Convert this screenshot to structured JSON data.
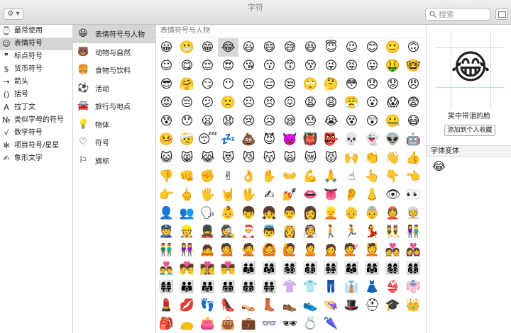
{
  "window": {
    "title": "字符"
  },
  "toolbar": {
    "gear_label": "⚙ ▾"
  },
  "search": {
    "placeholder": "搜索"
  },
  "categories": [
    {
      "icon": "⌚",
      "label": "最常使用",
      "selected": false
    },
    {
      "icon": "☺",
      "label": "表情符号",
      "selected": true
    },
    {
      "icon": "❞",
      "label": "标点符号",
      "selected": false
    },
    {
      "icon": "$",
      "label": "货币符号",
      "selected": false
    },
    {
      "icon": "→",
      "label": "箭头",
      "selected": false
    },
    {
      "icon": "()",
      "label": "括号",
      "selected": false
    },
    {
      "icon": "A",
      "label": "拉丁文",
      "selected": false
    },
    {
      "icon": "№",
      "label": "类似字母的符号",
      "selected": false
    },
    {
      "icon": "√",
      "label": "数学符号",
      "selected": false
    },
    {
      "icon": "✻",
      "label": "项目符号/星星",
      "selected": false
    },
    {
      "icon": "✍",
      "label": "象形文字",
      "selected": false
    }
  ],
  "subcategories": [
    {
      "icon": "😀",
      "label": "表情符号与人物",
      "selected": true
    },
    {
      "icon": "🐻",
      "label": "动物与自然",
      "selected": false
    },
    {
      "icon": "🍔",
      "label": "食物与饮料",
      "selected": false
    },
    {
      "icon": "⚽",
      "label": "活动",
      "selected": false
    },
    {
      "icon": "🚘",
      "label": "旅行与地点",
      "selected": false
    },
    {
      "icon": "💡",
      "label": "物体",
      "selected": false
    },
    {
      "icon": "♡",
      "label": "符号",
      "selected": false
    },
    {
      "icon": "⚐",
      "label": "旗标",
      "selected": false
    }
  ],
  "grid": {
    "heading": "表情符号与人物",
    "selected_index": 3,
    "rows": [
      [
        "😀",
        "😬",
        "😁",
        "😂",
        "😃",
        "😄",
        "😅",
        "😆",
        "😇",
        "😉",
        "😊",
        "🙂",
        "🙃"
      ],
      [
        "☺",
        "😋",
        "😌",
        "😍",
        "😘",
        "😗",
        "😙",
        "😚",
        "😜",
        "😝",
        "😛",
        "🤑",
        "🤓"
      ],
      [
        "😎",
        "🤗",
        "😏",
        "😶",
        "😐",
        "😑",
        "😒",
        "🙄",
        "🤔",
        "😳",
        "😞",
        "😟",
        "😠"
      ],
      [
        "😡",
        "😔",
        "😕",
        "🙁",
        "☹",
        "😣",
        "😖",
        "😫",
        "😩",
        "😤",
        "😮",
        "😱",
        "😨"
      ],
      [
        "😰",
        "😯",
        "😦",
        "😧",
        "😢",
        "😥",
        "😪",
        "😓",
        "😭",
        "😵",
        "😲",
        "🤐",
        "😷"
      ],
      [
        "🤒",
        "🤕",
        "😴",
        "💤",
        "💩",
        "😈",
        "👿",
        "👹",
        "👺",
        "💀",
        "👻",
        "👽",
        "🤖"
      ],
      [
        "😺",
        "😸",
        "😹",
        "😻",
        "😼",
        "😽",
        "🙀",
        "😿",
        "😾",
        "🙌",
        "👏",
        "👋",
        "👍"
      ],
      [
        "👎",
        "👊",
        "✊",
        "✌",
        "👌",
        "✋",
        "👐",
        "💪",
        "🙏",
        "☝",
        "👆",
        "👇",
        "👈"
      ],
      [
        "👉",
        "🖕",
        "🖐",
        "🤘",
        "🖖",
        "✍",
        "💅",
        "👄",
        "👅",
        "👂",
        "👃",
        "👁",
        "👀"
      ],
      [
        "👤",
        "👥",
        "🗣",
        "👶",
        "👦",
        "👧",
        "👨",
        "👩",
        "👱",
        "👴",
        "👵",
        "👲",
        "👳"
      ],
      [
        "👮",
        "👷",
        "💂",
        "🕵",
        "🎅",
        "👼",
        "👸",
        "👰",
        "🚶",
        "🏃",
        "💃",
        "👯",
        "👫"
      ],
      [
        "👬",
        "👭",
        "🙇",
        "💁",
        "🙅",
        "🙆",
        "🙋",
        "🙎",
        "🙍",
        "💇",
        "💆",
        "💑",
        "👩‍❤️‍👩"
      ],
      [
        "👨‍❤️‍👨",
        "💏",
        "👩‍❤️‍💋‍👩",
        "👨‍❤️‍💋‍👨",
        "👪",
        "👨‍👩‍👧",
        "👨‍👩‍👧‍👦",
        "👨‍👩‍👦‍👦",
        "👨‍👩‍👧‍👧",
        "👩‍👩‍👦",
        "👩‍👩‍👧",
        "👩‍👩‍👧‍👦",
        "👩‍👩‍👦‍👦"
      ],
      [
        "👩‍👩‍👧‍👧",
        "👨‍👨‍👦",
        "👨‍👨‍👧",
        "👨‍👨‍👧‍👦",
        "👨‍👨‍👦‍👦",
        "👨‍👨‍👧‍👧",
        "👚",
        "👕",
        "👖",
        "👔",
        "👗",
        "👙",
        "👘"
      ],
      [
        "💄",
        "💋",
        "👣",
        "👠",
        "👡",
        "👢",
        "👞",
        "👟",
        "👒",
        "🎩",
        "⛑",
        "🎓",
        "👑"
      ],
      [
        "🎒",
        "👝",
        "👛",
        "👜",
        "💼",
        "👓",
        "🕶",
        "💍",
        "🌂"
      ]
    ]
  },
  "detail": {
    "char": "😂",
    "name": "笑中带泪的脸",
    "add_favorite_label": "添加到个人收藏",
    "variant_heading": "字体变体",
    "variants": [
      "😂"
    ]
  }
}
